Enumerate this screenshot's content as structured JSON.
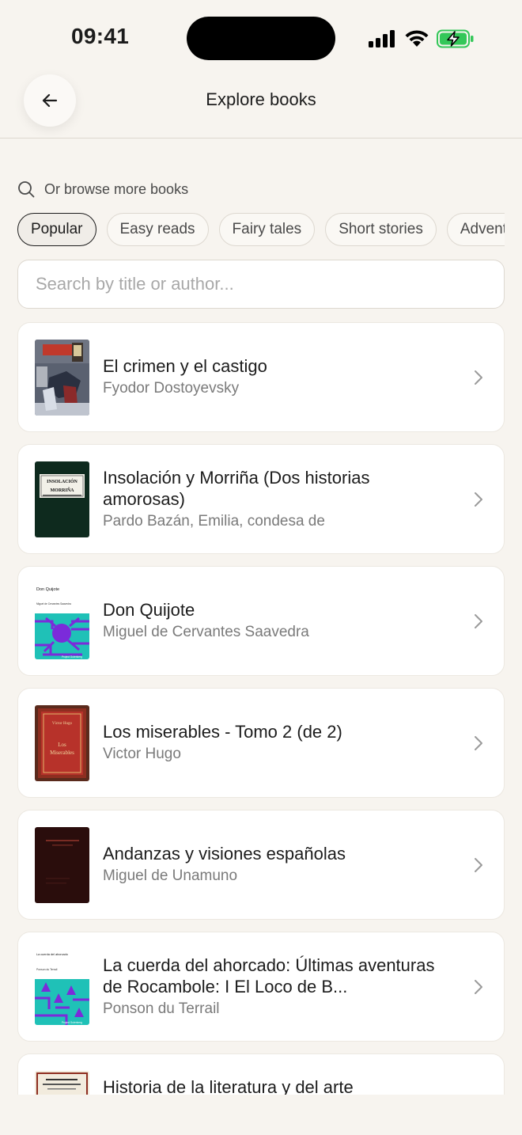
{
  "status_bar": {
    "time": "09:41"
  },
  "header": {
    "title": "Explore books"
  },
  "browse": {
    "label": "Or browse more books"
  },
  "chips": [
    "Popular",
    "Easy reads",
    "Fairy tales",
    "Short stories",
    "Adventure"
  ],
  "active_chip": "Popular",
  "search": {
    "placeholder": "Search by title or author..."
  },
  "books": [
    {
      "title": "El crimen y el castigo",
      "author": "Fyodor Dostoyevsky"
    },
    {
      "title": "Insolación y Morriña (Dos historias amorosas)",
      "author": "Pardo Bazán, Emilia, condesa de"
    },
    {
      "title": "Don Quijote",
      "author": "Miguel de Cervantes Saavedra"
    },
    {
      "title": "Los miserables - Tomo 2 (de 2)",
      "author": "Victor Hugo"
    },
    {
      "title": "Andanzas y visiones españolas",
      "author": "Miguel de Unamuno"
    },
    {
      "title": "La cuerda del ahorcado: Últimas aventuras de Rocambole: I El Loco de B...",
      "author": "Ponson du Terrail"
    },
    {
      "title": "Historia de la literatura y del arte",
      "author": ""
    }
  ],
  "covers": {
    "insolacion": {
      "line1": "INSOLACIÓN",
      "line2": "MORRIÑA"
    },
    "quijote": {
      "title": "Don Quijote",
      "author": "Miguel de Cervantes Saavedra",
      "footer": "Project Gutenberg"
    },
    "miserables": {
      "author": "Víctor Hugo",
      "line1": "Los",
      "line2": "Miserables"
    },
    "cuerda": {
      "title": "La cuerda del ahorcado",
      "author": "Ponson du Terrail",
      "footer": "Project Gutenberg"
    }
  },
  "colors": {
    "background": "#F7F4EF",
    "card": "#FFFFFF",
    "text": "#1C1C1C",
    "muted": "#7A7A7A",
    "battery": "#34C759"
  }
}
